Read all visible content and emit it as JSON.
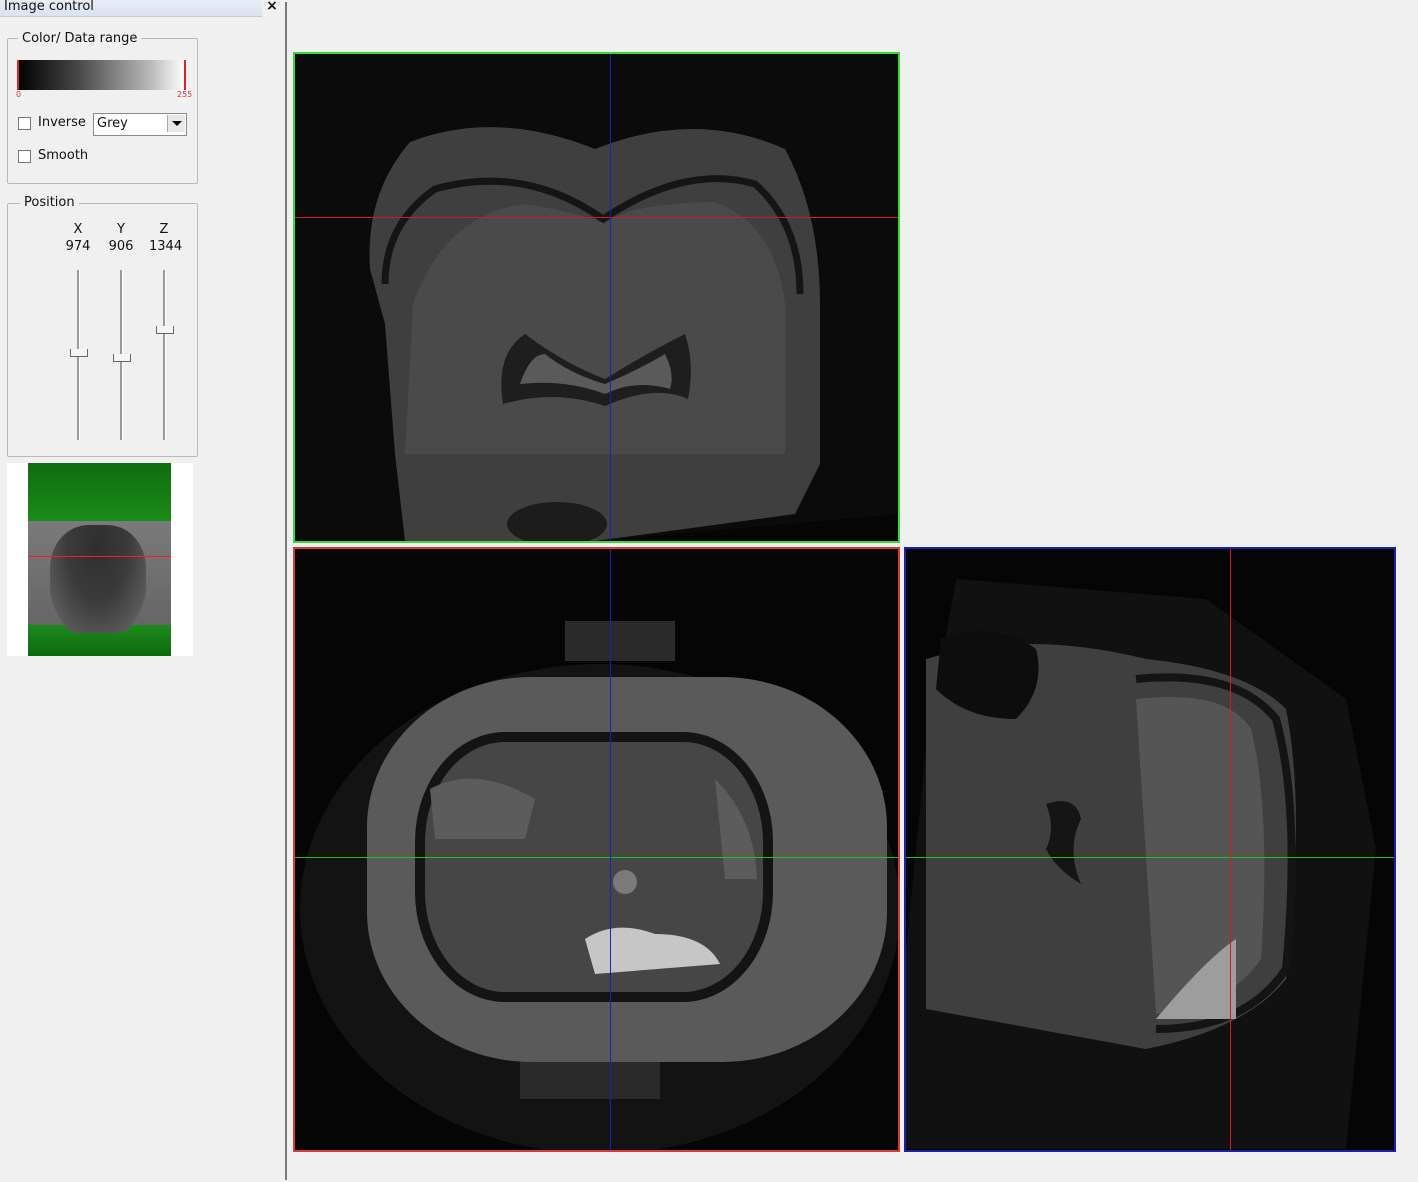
{
  "panel": {
    "title": "Image control",
    "close_glyph": "×"
  },
  "color_range": {
    "group_title": "Color/ Data range",
    "min_label": "0",
    "max_label": "255",
    "inverse_label": "Inverse",
    "colormap_value": "Grey",
    "smooth_label": "Smooth"
  },
  "position": {
    "group_title": "Position",
    "x_label": "X",
    "y_label": "Y",
    "z_label": "Z",
    "x_value": "974",
    "y_value": "906",
    "z_value": "1344"
  },
  "colors": {
    "axial_frame": "#38d838",
    "coronal_frame": "#d43b3b",
    "sagittal_frame": "#1f1fa8",
    "cross_red": "#d41a1a",
    "cross_blue": "#1c1cc8",
    "cross_green": "#22c022"
  },
  "icons": [
    "close-icon",
    "checkbox-icon",
    "dropdown-arrow-icon",
    "slider-thumb-icon"
  ]
}
